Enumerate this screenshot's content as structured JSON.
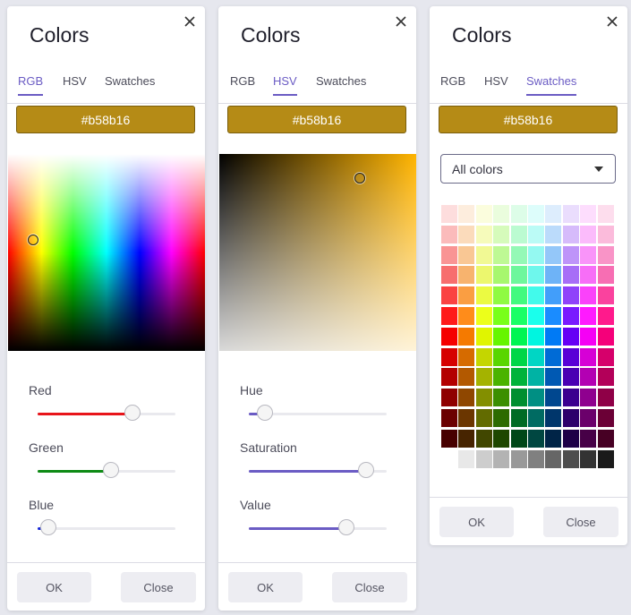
{
  "dialogs": [
    {
      "title": "Colors",
      "tabs": [
        "RGB",
        "HSV",
        "Swatches"
      ],
      "active_tab": "RGB",
      "hex_value": "#b58b16",
      "sliders": [
        {
          "label": "Red",
          "level": 0.69,
          "fill_color": "#e8141a"
        },
        {
          "label": "Green",
          "level": 0.53,
          "fill_color": "#0d8a14"
        },
        {
          "label": "Blue",
          "level": 0.08,
          "fill_color": "#1a2ad8"
        }
      ],
      "ok_label": "OK",
      "close_label": "Close"
    },
    {
      "title": "Colors",
      "tabs": [
        "RGB",
        "HSV",
        "Swatches"
      ],
      "active_tab": "HSV",
      "hex_value": "#b58b16",
      "sliders": [
        {
          "label": "Hue",
          "level": 0.12,
          "fill_color": "#6b5cc4"
        },
        {
          "label": "Saturation",
          "level": 0.85,
          "fill_color": "#6b5cc4"
        },
        {
          "label": "Value",
          "level": 0.71,
          "fill_color": "#6b5cc4"
        }
      ],
      "ok_label": "OK",
      "close_label": "Close"
    },
    {
      "title": "Colors",
      "tabs": [
        "RGB",
        "HSV",
        "Swatches"
      ],
      "active_tab": "Swatches",
      "hex_value": "#b58b16",
      "select_value": "All colors",
      "ok_label": "OK",
      "close_label": "Close"
    }
  ],
  "current_color": "#b58b16",
  "accent_color": "#6b5cc4",
  "swatch_hues": [
    0,
    30,
    65,
    95,
    140,
    175,
    210,
    265,
    300,
    330
  ],
  "swatch_levels": [
    {
      "s": 90,
      "l": 93
    },
    {
      "s": 90,
      "l": 86
    },
    {
      "s": 90,
      "l": 78
    },
    {
      "s": 90,
      "l": 70
    },
    {
      "s": 95,
      "l": 62
    },
    {
      "s": 100,
      "l": 55
    },
    {
      "s": 100,
      "l": 48
    },
    {
      "s": 100,
      "l": 42
    },
    {
      "s": 100,
      "l": 35
    },
    {
      "s": 100,
      "l": 28
    },
    {
      "s": 100,
      "l": 21
    },
    {
      "s": 100,
      "l": 14
    }
  ],
  "swatch_grays": [
    "#ffffff",
    "#e8e8e8",
    "#cdcdcd",
    "#b3b3b3",
    "#999999",
    "#808080",
    "#666666",
    "#4d4d4d",
    "#333333",
    "#1a1a1a"
  ]
}
